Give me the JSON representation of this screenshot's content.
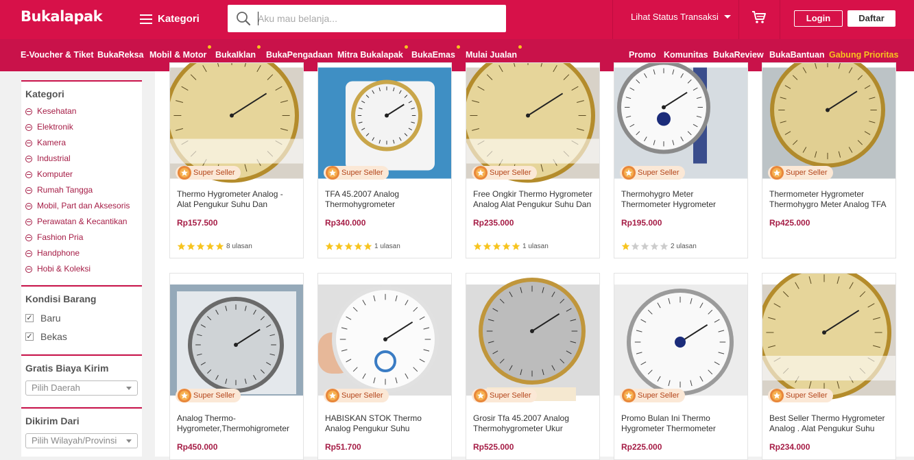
{
  "header": {
    "logo": "Bukalapak",
    "kategori_label": "Kategori",
    "search_placeholder": "Aku mau belanja...",
    "status_label": "Lihat Status Transaksi",
    "login_label": "Login",
    "daftar_label": "Daftar",
    "brand_color": "#d71149"
  },
  "subnav": {
    "left": [
      {
        "label": "E-Voucher & Tiket",
        "dot": false
      },
      {
        "label": "BukaReksa",
        "dot": false
      },
      {
        "label": "Mobil & Motor",
        "dot": true
      },
      {
        "label": "BukaIklan",
        "dot": true
      },
      {
        "label": "BukaPengadaan",
        "dot": false
      },
      {
        "label": "Mitra Bukalapak",
        "dot": true
      },
      {
        "label": "BukaEmas",
        "dot": true
      },
      {
        "label": "Mulai Jualan",
        "dot": true
      }
    ],
    "right": [
      "Promo",
      "Komunitas",
      "BukaReview",
      "BukaBantuan",
      "Gabung Prioritas"
    ]
  },
  "sidebar": {
    "kategori_title": "Kategori",
    "categories": [
      "Kesehatan",
      "Elektronik",
      "Kamera",
      "Industrial",
      "Komputer",
      "Rumah Tangga",
      "Mobil, Part dan Aksesoris",
      "Perawatan & Kecantikan",
      "Fashion Pria",
      "Handphone",
      "Hobi & Koleksi"
    ],
    "kondisi_title": "Kondisi Barang",
    "kondisi_options": [
      {
        "label": "Baru",
        "checked": true
      },
      {
        "label": "Bekas",
        "checked": true
      }
    ],
    "gratis_title": "Gratis Biaya Kirim",
    "gratis_select": "Pilih Daerah",
    "dikirim_title": "Dikirim Dari",
    "dikirim_select": "Pilih Wilayah/Provinsi"
  },
  "badge_label": "Super Seller",
  "products": [
    {
      "name": "Thermo Hygrometer Analog - Alat Pengukur Suhu Dan",
      "price": "Rp157.500",
      "rating": 5,
      "reviews": "8 ulasan",
      "image": "gold-hygrometer"
    },
    {
      "name": "TFA 45.2007 Analog Thermohygrometer",
      "price": "Rp340.000",
      "rating": 5,
      "reviews": "1 ulasan",
      "image": "tfa-hygrometer-box"
    },
    {
      "name": "Free Ongkir Thermo Hygrometer Analog Alat Pengukur Suhu Dan",
      "price": "Rp235.000",
      "rating": 5,
      "reviews": "1 ulasan",
      "image": "gold-hygrometer"
    },
    {
      "name": "Thermohygro Meter Thermometer Hygrometer",
      "price": "Rp195.000",
      "rating": 1,
      "reviews": "2 ulasan",
      "image": "anymetre-side"
    },
    {
      "name": "Thermometer Hygrometer Thermohygro Meter Analog TFA",
      "price": "Rp425.000",
      "rating": 0,
      "reviews": "",
      "image": "gold-hygrometer-closeup"
    },
    {
      "name": "Analog Thermo-Hygrometer,Thermohigrometer",
      "price": "Rp450.000",
      "rating": 0,
      "reviews": "",
      "image": "silver-hygrometer-box"
    },
    {
      "name": "HABISKAN STOK Thermo Analog Pengukur Suhu",
      "price": "Rp51.700",
      "rating": 0,
      "reviews": "",
      "image": "white-hygrometer-hand"
    },
    {
      "name": "Grosir Tfa 45.2007 Analog Thermohygrometer Ukur",
      "price": "Rp525.000",
      "rating": 0,
      "reviews": "",
      "image": "tfa-silver-wall"
    },
    {
      "name": "Promo Bulan Ini Thermo Hygrometer Thermometer",
      "price": "Rp225.000",
      "rating": 0,
      "reviews": "",
      "image": "anymetre-front"
    },
    {
      "name": "Best Seller Thermo Hygrometer Analog . Alat Pengukur Suhu",
      "price": "Rp234.000",
      "rating": 0,
      "reviews": "",
      "image": "gold-hygrometer"
    }
  ]
}
